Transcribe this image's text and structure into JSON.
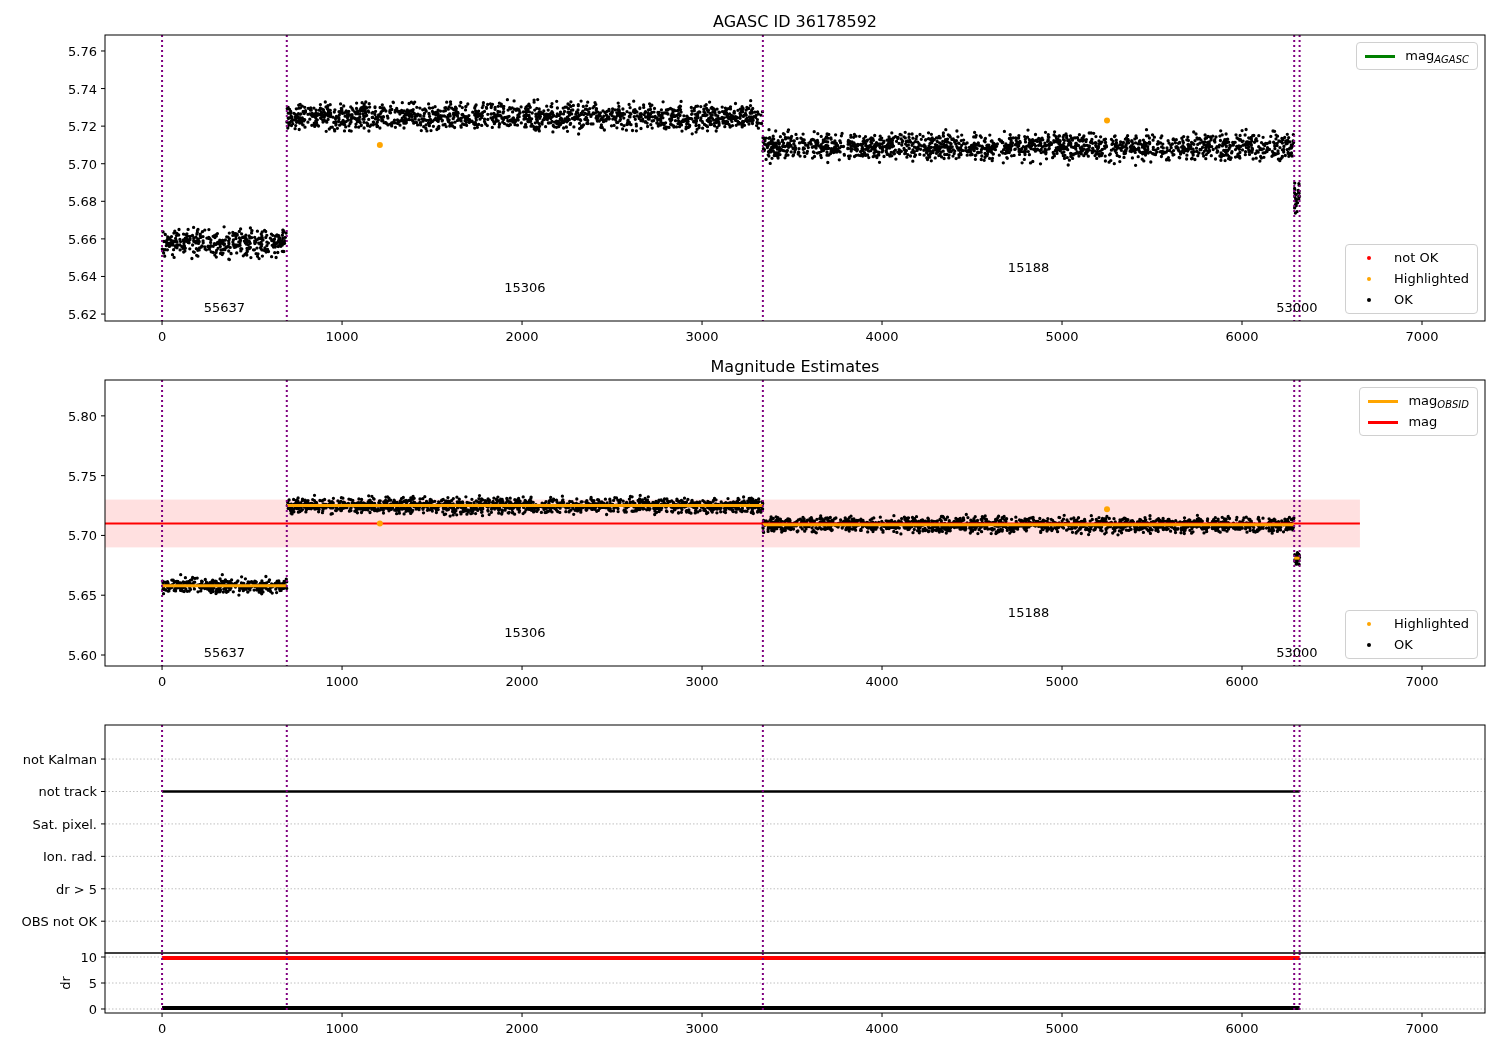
{
  "panels": [
    {
      "chart_data": {
        "type": "scatter",
        "title": "AGASC ID 36178592",
        "xlim": [
          -317,
          7350
        ],
        "ylim": [
          5.6163,
          5.7685
        ],
        "xticks": [
          0,
          1000,
          2000,
          3000,
          4000,
          5000,
          6000,
          7000
        ],
        "yticks": [
          {
            "value": 5.62,
            "label": "5.62"
          },
          {
            "value": 5.64,
            "label": "5.64"
          },
          {
            "value": 5.66,
            "label": "5.66"
          },
          {
            "value": 5.68,
            "label": "5.68"
          },
          {
            "value": 5.7,
            "label": "5.70"
          },
          {
            "value": 5.72,
            "label": "5.72"
          },
          {
            "value": 5.74,
            "label": "5.74"
          },
          {
            "value": 5.76,
            "label": "5.76"
          }
        ],
        "series": [
          {
            "color": "#ffa500",
            "x": [
              1210,
              5250
            ],
            "values": [
              5.71,
              5.723
            ]
          }
        ],
        "ref_lines": [
          {
            "axis": "x",
            "value": 0
          },
          {
            "axis": "x",
            "value": 693
          },
          {
            "axis": "x",
            "value": 3338
          },
          {
            "axis": "x",
            "value": 6290
          },
          {
            "axis": "x",
            "value": 6320
          }
        ],
        "annotations": [
          "55637",
          "15306",
          "15188",
          "53000"
        ]
      },
      "legends": [
        {
          "items": [
            {
              "kind": "line",
              "label": "mag$_{AGASC}$",
              "color": "#008000"
            }
          ]
        },
        {
          "items": [
            {
              "kind": "marker",
              "label": "not OK",
              "color": "#ff0000"
            },
            {
              "kind": "marker",
              "label": "Highlighted",
              "color": "#ffa500"
            },
            {
              "kind": "marker",
              "label": "OK",
              "color": "#000000"
            }
          ]
        }
      ]
    },
    {
      "chart_data": {
        "type": "scatter",
        "title": "Magnitude Estimates",
        "xlim": [
          -317,
          7350
        ],
        "ylim": [
          5.5908,
          5.83
        ],
        "xticks": [
          0,
          1000,
          2000,
          3000,
          4000,
          5000,
          6000,
          7000
        ],
        "yticks": [
          {
            "value": 5.6,
            "label": "5.60"
          },
          {
            "value": 5.65,
            "label": "5.65"
          },
          {
            "value": 5.7,
            "label": "5.70"
          },
          {
            "value": 5.75,
            "label": "5.75"
          },
          {
            "value": 5.8,
            "label": "5.80"
          }
        ],
        "bands": [
          {
            "axis": "y",
            "from": 5.69,
            "to": 5.73,
            "color": "#ffe0e0"
          }
        ],
        "series": [
          {
            "type": "line",
            "color": "#ff0000",
            "x": [
              -317,
              6655
            ],
            "values": [
              5.71,
              5.71
            ]
          },
          {
            "type": "line",
            "color": "#ffa500",
            "x": [
              0,
              693
            ],
            "values": [
              5.658,
              5.658
            ]
          },
          {
            "type": "line",
            "color": "#ffa500",
            "x": [
              693,
              3338
            ],
            "values": [
              5.725,
              5.725
            ]
          },
          {
            "type": "line",
            "color": "#ffa500",
            "x": [
              3338,
              6290
            ],
            "values": [
              5.709,
              5.709
            ]
          },
          {
            "type": "line",
            "color": "#ffa500",
            "x": [
              6290,
              6320
            ],
            "values": [
              5.681,
              5.681
            ]
          },
          {
            "color": "#ffa500",
            "x": [
              1210,
              5250
            ],
            "values": [
              5.71,
              5.722
            ]
          }
        ],
        "ref_lines": [
          {
            "axis": "x",
            "value": 0
          },
          {
            "axis": "x",
            "value": 693
          },
          {
            "axis": "x",
            "value": 3338
          },
          {
            "axis": "x",
            "value": 6290
          },
          {
            "axis": "x",
            "value": 6320
          }
        ],
        "annotations": [
          "55637",
          "15306",
          "15188",
          "53000"
        ]
      },
      "legends": [
        {
          "items": [
            {
              "kind": "line",
              "label": "mag$_{OBSID}$",
              "color": "#ffa500"
            },
            {
              "kind": "line",
              "label": "mag",
              "color": "#ff0000"
            }
          ]
        },
        {
          "items": [
            {
              "kind": "marker",
              "label": "Highlighted",
              "color": "#ffa500"
            },
            {
              "kind": "marker",
              "label": "OK",
              "color": "#000000"
            }
          ]
        }
      ]
    },
    {
      "flag_rows": [
        {
          "label": "not Kalman",
          "flagged": false
        },
        {
          "label": "not track",
          "flagged": true
        },
        {
          "label": "Sat. pixel.",
          "flagged": false
        },
        {
          "label": "Ion. rad.",
          "flagged": false
        },
        {
          "label": "dr > 5",
          "flagged": false
        },
        {
          "label": "OBS not OK",
          "flagged": false
        }
      ]
    },
    {
      "chart_data": {
        "type": "line",
        "grid": true,
        "ylabel": "dr",
        "xlim": [
          -317,
          7350
        ],
        "ylim": [
          -0.77,
          10.77
        ],
        "xticks": [
          0,
          1000,
          2000,
          3000,
          4000,
          5000,
          6000,
          7000
        ],
        "yticks": [
          0,
          5,
          10
        ],
        "series": [
          {
            "color": "#ff0000",
            "x": [
              0,
              6320
            ],
            "values": [
              9.8,
              9.8
            ]
          },
          {
            "color": "#000000",
            "x": [
              0,
              6320
            ],
            "values": [
              0.2,
              0.2
            ]
          }
        ],
        "ref_lines": [
          {
            "axis": "x",
            "value": 0
          },
          {
            "axis": "x",
            "value": 693
          },
          {
            "axis": "x",
            "value": 3338
          },
          {
            "axis": "x",
            "value": 6290
          },
          {
            "axis": "x",
            "value": 6320
          }
        ]
      }
    }
  ]
}
